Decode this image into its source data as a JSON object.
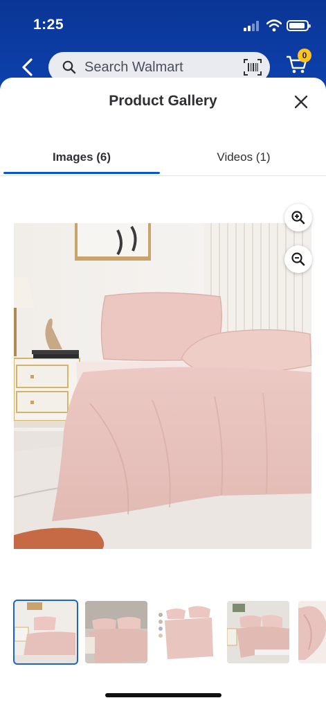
{
  "status_bar": {
    "time": "1:25"
  },
  "header": {
    "search": {
      "placeholder": "Search Walmart"
    },
    "cart": {
      "count": "0"
    }
  },
  "gallery": {
    "title": "Product Gallery",
    "tabs": [
      {
        "label": "Images (6)",
        "selected": true
      },
      {
        "label": "Videos (1)",
        "selected": false
      }
    ],
    "selected_thumbnail_index": 0,
    "thumbnail_count_visible": 5
  },
  "icons": {
    "back": "chevron-left-icon",
    "search": "search-icon",
    "barcode": "barcode-scan-icon",
    "cart": "cart-icon",
    "close": "close-icon",
    "zoom_in": "zoom-in-icon",
    "zoom_out": "zoom-out-icon"
  },
  "colors": {
    "header_blue": "#0b3aa0",
    "accent_blue": "#0a53d6",
    "cart_badge": "#ffc220",
    "product_pink": "#e9c5c0"
  }
}
